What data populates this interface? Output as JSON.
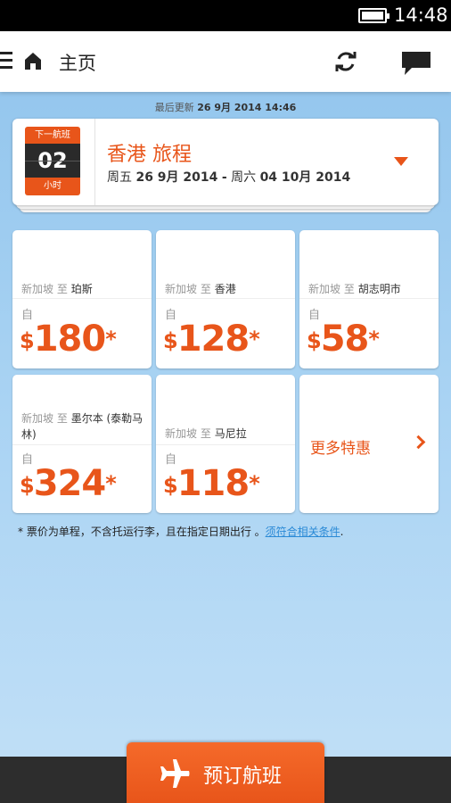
{
  "status": {
    "time": "14:48"
  },
  "actionbar": {
    "title": "主页"
  },
  "updated": {
    "prefix": "最后更新",
    "value": "26 9月 2014 14:46"
  },
  "trip": {
    "countdown_label": "下一航班",
    "countdown_value": "02",
    "countdown_unit": "小时",
    "title": "香港 旅程",
    "depart_day": "周五",
    "depart_date": "26 9月 2014",
    "separator": "-",
    "return_day": "周六",
    "return_date": "04 10月 2014"
  },
  "deals": [
    {
      "origin": "新加坡",
      "to": "至",
      "dest": "珀斯",
      "from": "自",
      "currency": "$",
      "price": "180",
      "ast": "*"
    },
    {
      "origin": "新加坡",
      "to": "至",
      "dest": "香港",
      "from": "自",
      "currency": "$",
      "price": "128",
      "ast": "*"
    },
    {
      "origin": "新加坡",
      "to": "至",
      "dest": "胡志明市",
      "from": "自",
      "currency": "$",
      "price": "58",
      "ast": "*"
    },
    {
      "origin": "新加坡",
      "to": "至",
      "dest": "墨尔本 (泰勒马林)",
      "from": "自",
      "currency": "$",
      "price": "324",
      "ast": "*"
    },
    {
      "origin": "新加坡",
      "to": "至",
      "dest": "马尼拉",
      "from": "自",
      "currency": "$",
      "price": "118",
      "ast": "*"
    }
  ],
  "more_deals": "更多特惠",
  "footnote": {
    "text": "* 票价为单程，不含托运行李，且在指定日期出行 。",
    "link": "须符合相关条件",
    "end": "."
  },
  "book_button": "预订航班",
  "colors": {
    "accent": "#e8551a",
    "link": "#2a8ad6"
  }
}
